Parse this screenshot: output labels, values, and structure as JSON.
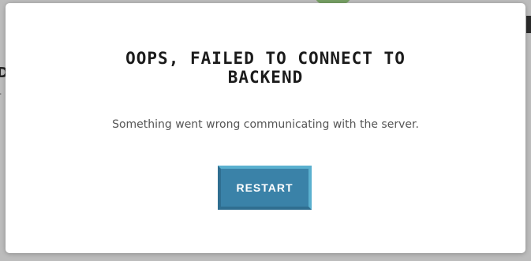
{
  "modal": {
    "title": "OOPS, FAILED TO CONNECT TO BACKEND",
    "message": "Something went wrong communicating with the server.",
    "restart_label": "RESTART"
  },
  "background": {
    "left_text_1": "D",
    "left_text_2": "r"
  },
  "colors": {
    "button": "#3a82a8",
    "button_highlight": "#5ab0cf",
    "title": "#1b1b1b",
    "message": "#555555"
  }
}
